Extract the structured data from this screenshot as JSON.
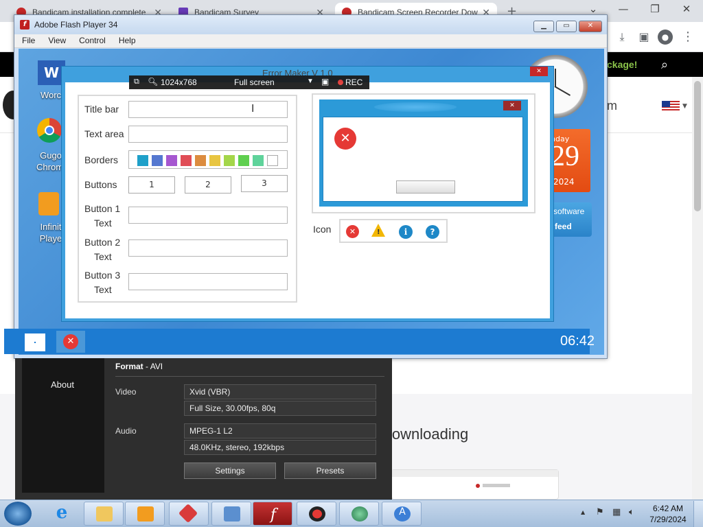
{
  "browser": {
    "tabs": [
      {
        "title": "Bandicam installation complete",
        "active": false
      },
      {
        "title": "Bandicam Survey",
        "active": false
      },
      {
        "title": "Bandicam Screen Recorder Dow",
        "active": true
      }
    ],
    "new_tab": "+",
    "window_controls": {
      "minimize": "—",
      "restore": "❐",
      "close": "✕",
      "tab_search": "⌄"
    }
  },
  "website": {
    "header_text": "m",
    "promo_text": "ckage!",
    "heading": "lownloading",
    "language_flag": "us-flag-icon"
  },
  "flash_window": {
    "title": "Adobe Flash Player 34",
    "menu": [
      "File",
      "View",
      "Control",
      "Help"
    ]
  },
  "desktop": {
    "icons": [
      "Worc",
      "Gugo\nChromi",
      "Infinit\nPlaye"
    ],
    "clock_day": "nday",
    "clock_date": "29",
    "clock_year": "2024",
    "software_text": "software",
    "feed_text": "s feed",
    "time": "06:42"
  },
  "error_maker": {
    "title": "Error Maker V 1.0",
    "labels": {
      "title_bar": "Title bar",
      "text_area": "Text area",
      "borders": "Borders",
      "buttons": "Buttons",
      "button1": [
        "Button 1",
        "Text"
      ],
      "button2": [
        "Button 2",
        "Text"
      ],
      "button3": [
        "Button 3",
        "Text"
      ],
      "icon": "Icon"
    },
    "button_numbers": [
      "1",
      "2",
      "3"
    ],
    "border_colors": [
      "#1fa0c9",
      "#5578d0",
      "#a657d0",
      "#e04d56",
      "#dc8c3f",
      "#e8c541",
      "#a4d64a",
      "#5fcf4f",
      "#5fd39b",
      "#ffffff"
    ]
  },
  "bandicam_bar": {
    "resolution": "1024x768",
    "mode": "Full screen",
    "rec": "REC"
  },
  "bandicam_settings": {
    "about": "About",
    "format_label": "Format",
    "format_value": "AVI",
    "video_label": "Video",
    "video_codec": "Xvid (VBR)",
    "video_details": "Full Size, 30.00fps, 80q",
    "audio_label": "Audio",
    "audio_codec": "MPEG-1 L2",
    "audio_details": "48.0KHz, stereo, 192kbps",
    "settings_btn": "Settings",
    "presets_btn": "Presets"
  },
  "taskbar": {
    "time": "6:42 AM",
    "date": "7/29/2024",
    "apps": [
      "internet-explorer-icon",
      "folder-icon",
      "media-player-icon",
      "app-red-icon",
      "display-settings-icon",
      "flash-icon",
      "bandicam-icon",
      "network-globe-icon",
      "installer-icon"
    ]
  }
}
